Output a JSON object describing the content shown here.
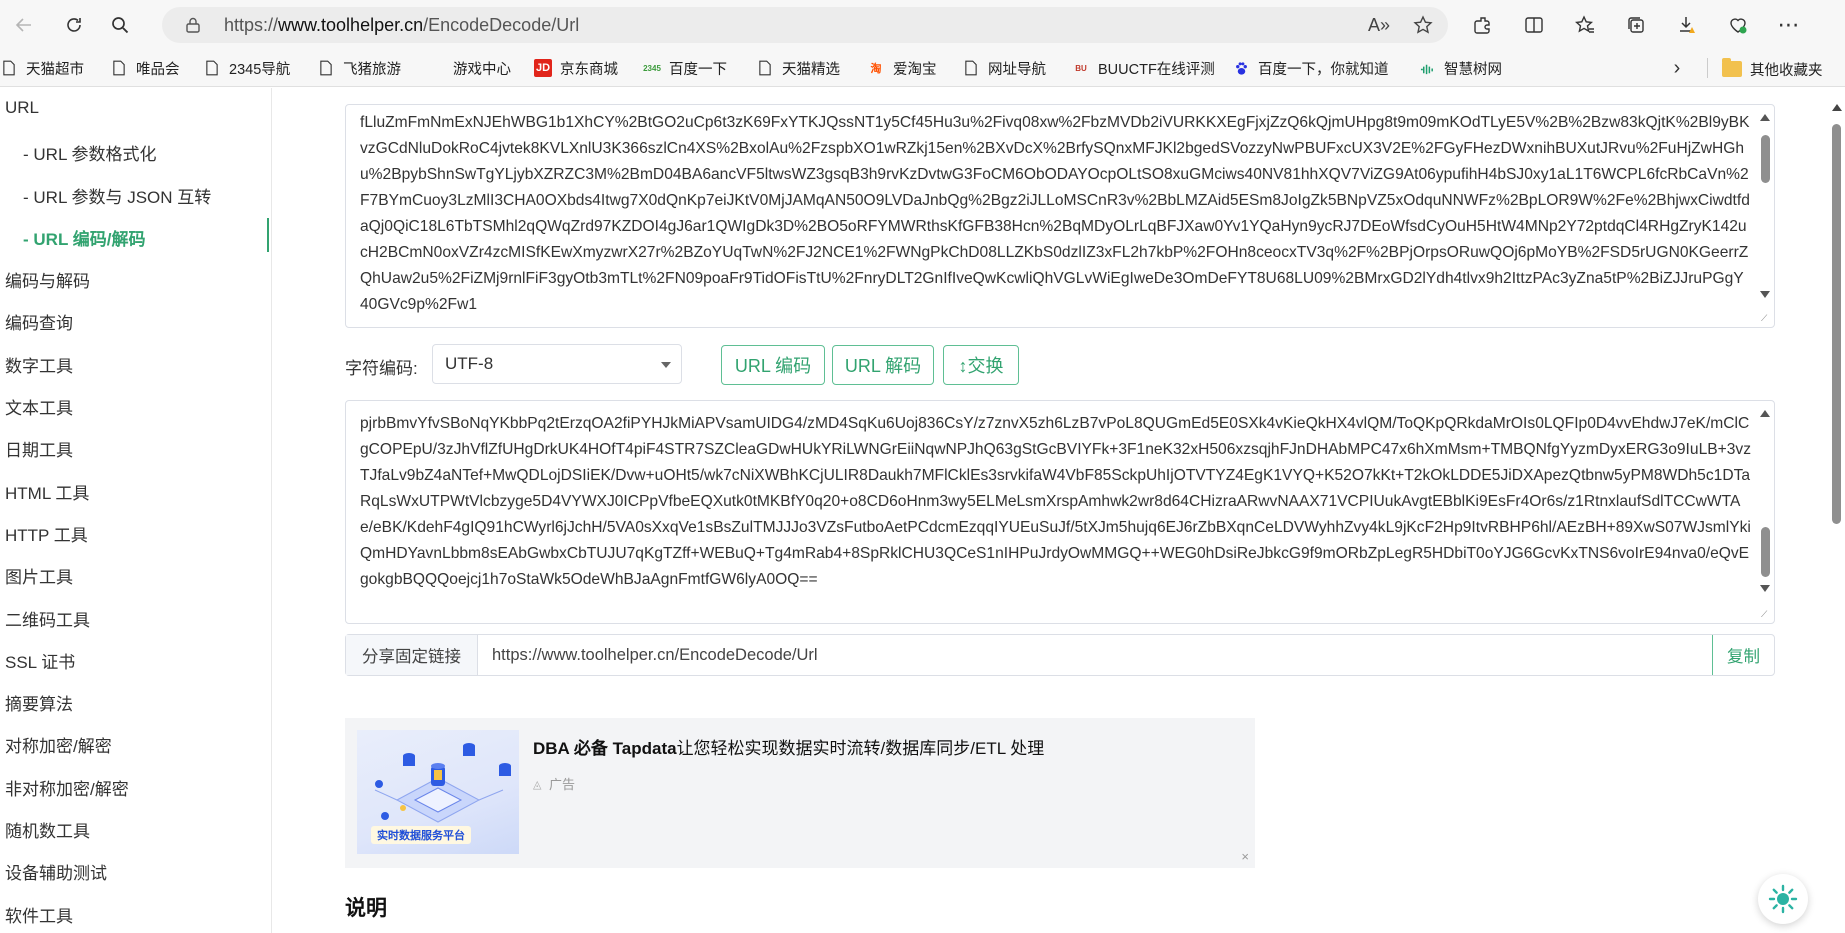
{
  "browser": {
    "url_prefix": "https://",
    "url_host": "www.toolhelper.cn",
    "url_path": "/EncodeDecode/Url",
    "read_aloud_icon": "A»"
  },
  "bookmarks": [
    {
      "label": "天猫超市",
      "icon": "doc-icon"
    },
    {
      "label": "唯品会",
      "icon": "doc-icon"
    },
    {
      "label": "2345导航",
      "icon": "doc-icon"
    },
    {
      "label": "飞猪旅游",
      "icon": "doc-icon"
    },
    {
      "label": "游戏中心",
      "icon": "blank-icon"
    },
    {
      "label": "京东商城",
      "icon": "jd-icon",
      "icon_text": "JD"
    },
    {
      "label": "百度一下",
      "icon": "2345-icon",
      "icon_text": "2345"
    },
    {
      "label": "天猫精选",
      "icon": "doc-icon"
    },
    {
      "label": "爱淘宝",
      "icon": "taobao-icon",
      "icon_text": "淘"
    },
    {
      "label": "网址导航",
      "icon": "doc-icon"
    },
    {
      "label": "BUUCTF在线评测",
      "icon": "buuctf-icon",
      "icon_text": "BU"
    },
    {
      "label": "百度一下，你就知道",
      "icon": "baidu-paw-icon"
    },
    {
      "label": "智慧树网",
      "icon": "zhihuishu-icon"
    }
  ],
  "bookmarks_other": "其他收藏夹",
  "sidebar": {
    "items": [
      {
        "label": "URL",
        "sub": false,
        "active": false
      },
      {
        "label": "- URL 参数格式化",
        "sub": true,
        "active": false
      },
      {
        "label": "- URL 参数与 JSON 互转",
        "sub": true,
        "active": false
      },
      {
        "label": "- URL  编码/解码",
        "sub": true,
        "active": true
      },
      {
        "label": "编码与解码",
        "sub": false,
        "active": false
      },
      {
        "label": "编码查询",
        "sub": false,
        "active": false
      },
      {
        "label": "数字工具",
        "sub": false,
        "active": false
      },
      {
        "label": "文本工具",
        "sub": false,
        "active": false
      },
      {
        "label": "日期工具",
        "sub": false,
        "active": false
      },
      {
        "label": "HTML 工具",
        "sub": false,
        "active": false
      },
      {
        "label": "HTTP 工具",
        "sub": false,
        "active": false
      },
      {
        "label": "图片工具",
        "sub": false,
        "active": false
      },
      {
        "label": "二维码工具",
        "sub": false,
        "active": false
      },
      {
        "label": "SSL 证书",
        "sub": false,
        "active": false
      },
      {
        "label": "摘要算法",
        "sub": false,
        "active": false
      },
      {
        "label": "对称加密/解密",
        "sub": false,
        "active": false
      },
      {
        "label": "非对称加密/解密",
        "sub": false,
        "active": false
      },
      {
        "label": "随机数工具",
        "sub": false,
        "active": false
      },
      {
        "label": "设备辅助测试",
        "sub": false,
        "active": false
      },
      {
        "label": "软件工具",
        "sub": false,
        "active": false
      }
    ]
  },
  "input_area": {
    "text": "fLluZmFmNmExNJEhWBG1b1XhCY%2BtGO2uCp6t3zK69FxYTKJQssNT1y5Cf45Hu3u%2Fivq08xw%2FbzMVDb2iVURKKXEgFjxjZzQ6kQjmUHpg8t9m09mKOdTLyE5V%2B%2Bzw83kQjtK%2Bl9yBKvzGCdNluDokRoC4jvtek8KVLXnlU3K366szlCn4XS%2BxolAu%2FzspbXO1wRZkj15en%2BXvDcX%2BrfySQnxMFJKl2bgedSVozzyNwPBUFxcUX3V2E%2FGyFHezDWxnihBUXutJRvu%2FuHjZwHGhu%2BpybShnSwTgYLjybXZRZC3M%2BmD04BA6ancVF5ltwsWZ3gsqB3h9rvKzDvtwG3FoCM6ObODAYOcpOLtSO8xuGMciws40NV81hhXQV7ViZG9At06ypufihH4bSJ0xy1aL1T6WCPL6fcRbCaVn%2F7BYmCuoy3LzMlI3CHA0OXbds4Itwg7X0dQnKp7eiJKtV0MjJAMqAN50O9LVDaJnbQg%2Bgz2iJLLoMSCnR3v%2BbLMZAid5ESm8JoIgZk5BNpVZ5xOdquNNWFz%2BpLOR9W%2Fe%2BhjwxCiwdtfdaQj0QiC18L6TbTSMhl2qQWqZrd97KZDOI4gJ6ar1QWIgDk3D%2BO5oRFYMWRthsKfGFB38Hcn%2BqMDyOLrLqBFJXaw0Yv1YQaHyn9ycRJ7DEoWfsdCyOuH5HtW4MNp2Y72ptdqCl4RHgZryK142ucH2BCmN0oxVZr4zcMISfKEwXmyzwrX27r%2BZoYUqTwN%2FJ2NCE1%2FWNgPkChD08LLZKbS0dzlIZ3xFL2h7kbP%2FOHn8ceocxTV3q%2F%2BPjOrpsORuwQOj6pMoYB%2FSD5rUGN0KGeerrZQhUaw2u5%2FiZMj9rnlFiF3gyOtb3mTLt%2FN09poaFr9TidOFisTtU%2FnryDLT2GnIfIveQwKcwliQhVGLvWiEgIweDe3OmDeFYT8U68LU09%2BMrxGD2lYdh4tlvx9h2IttzPAc3yZna5tP%2BiZJJruPGgY40GVc9p%2Fw1"
  },
  "encoding": {
    "label": "字符编码:",
    "value": "UTF-8"
  },
  "actions": {
    "encode": "URL 编码",
    "decode": "URL 解码",
    "swap": "↕交换"
  },
  "output_area": {
    "text": "pjrbBmvYfvSBoNqYKbbPq2tErzqOA2fiPYHJkMiAPVsamUIDG4/zMD4SqKu6Uoj836CsY/z7znvX5zh6LzB7vPoL8QUGmEd5E0SXk4vKieQkHX4vlQM/ToQKpQRkdaMrOIs0LQFIp0D4vvEhdwJ7eK/mClCgCOPEpU/3zJhVflZfUHgDrkUK4HOfT4piF4STR7SZCleaGDwHUkYRiLWNGrEiiNqwNPJhQ63gStGcBVIYFk+3F1neK32xH506xzsqjhFJnDHAbMPC47x6hXmMsm+TMBQNfgYyzmDyxERG3o9IuLB+3vzTJfaLv9bZ4aNTef+MwQDLojDSIiEK/Dvw+uOHt5/wk7cNiXWBhKCjULIR8Daukh7MFlCklEs3srvkifaW4VbF85SckpUhIjOTVTYZ4EgK1VYQ+K52O7kKt+T2kOkLDDE5JiDXApezQtbnw5yPM8WDh5c1DTaRqLsWxUTPWtVlcbzyge5D4VYWXJ0ICPpVfbeEQXutk0tMKBfY0q20+o8CD6oHnm3wy5ELMeLsmXrspAmhwk2wr8d64CHizraARwvNAAX71VCPIUukAvgtEBblKi9EsFr4Or6s/z1RtnxlaufSdlTCCwWTAe/eBK/KdehF4gIQ91hCWyrl6jJchH/5VA0sXxqVe1sBsZulTMJJJo3VZsFutboAetPCdcmEzqqIYUEuSuJf/5tXJm5hujq6EJ6rZbBXqnCeLDVWyhhZvy4kL9jKcF2Hp9ItvRBHP6hl/AEzBH+89XwS07WJsmlYkiQmHDYavnLbbm8sEAbGwbxCbTUJU7qKgTZff+WEBuQ+Tg4mRab4+8SpRklCHU3QCeS1nIHPuJrdyOwMMGQ++WEG0hDsiReJbkcG9f9mORbZpLegR5HDbiT0oYJG6GcvKxTNS6voIrE94nva0/eQvEgokgbBQQQoejcj1h7oStaWk5OdeWhBJaAgnFmtfGW6lyA0OQ=="
  },
  "share": {
    "label": "分享固定链接",
    "url": "https://www.toolhelper.cn/EncodeDecode/Url",
    "copy": "复制"
  },
  "ad": {
    "title_bold": "DBA 必备 Tapdata",
    "title_rest": "让您轻松实现数据实时流转/数据库同步/ETL 处理",
    "tag": "广告",
    "image_caption": "实时数据服务平台",
    "close": "×"
  },
  "section": {
    "title": "说明"
  },
  "colors": {
    "accent": "#32a370",
    "border": "#dcdfe6"
  }
}
